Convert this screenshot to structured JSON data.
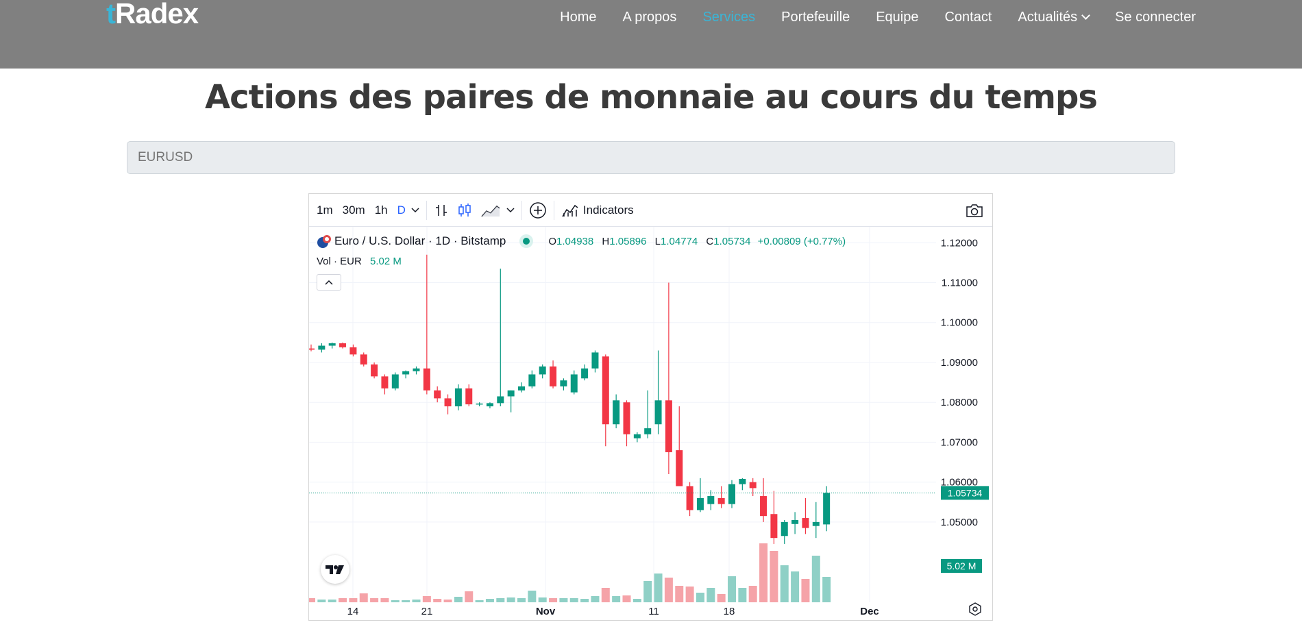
{
  "navbar": {
    "logo_prefix": "t",
    "logo_rest": "Radex",
    "links": [
      {
        "label": "Home"
      },
      {
        "label": "A propos"
      },
      {
        "label": "Services",
        "active": true
      },
      {
        "label": "Portefeuille"
      },
      {
        "label": "Equipe"
      },
      {
        "label": "Contact"
      },
      {
        "label": "Actualités",
        "dropdown": true
      },
      {
        "label": "Se connecter"
      }
    ]
  },
  "page": {
    "title": "Actions des paires de monnaie au cours du temps",
    "symbol_placeholder": "EURUSD"
  },
  "toolbar": {
    "intervals": [
      "1m",
      "30m",
      "1h",
      "D"
    ],
    "active_interval": "D",
    "indicators_label": "Indicators"
  },
  "legend": {
    "symbol_title": "Euro / U.S. Dollar · 1D · Bitstamp",
    "open_key": "O",
    "open": "1.04938",
    "high_key": "H",
    "high": "1.05896",
    "low_key": "L",
    "low": "1.04774",
    "close_key": "C",
    "close": "1.05734",
    "change": "+0.00809 (+0.77%)",
    "vol_label": "Vol · EUR",
    "vol_value": "5.02 M"
  },
  "colors": {
    "up": "#089981",
    "down": "#f23645",
    "up_vol": "#8fd0c6",
    "down_vol": "#f5a3a8",
    "accent": "#3ab5d6"
  },
  "chart_data": {
    "type": "candlestick",
    "y_ticks": [
      "1.12000",
      "1.11000",
      "1.10000",
      "1.09000",
      "1.08000",
      "1.07000",
      "1.06000",
      "1.05000"
    ],
    "x_ticks": [
      "14",
      "21",
      "Nov",
      "11",
      "18",
      "Dec"
    ],
    "last_price_label": "1.05734",
    "last_volume_label": "5.02 M",
    "ylim": [
      1.045,
      1.124
    ],
    "candles": [
      {
        "o": 1.0935,
        "h": 1.0945,
        "l": 1.0928,
        "c": 1.0932
      },
      {
        "o": 1.0932,
        "h": 1.0948,
        "l": 1.0925,
        "c": 1.0942
      },
      {
        "o": 1.0942,
        "h": 1.095,
        "l": 1.0935,
        "c": 1.0948
      },
      {
        "o": 1.0948,
        "h": 1.095,
        "l": 1.0935,
        "c": 1.0938
      },
      {
        "o": 1.0938,
        "h": 1.0945,
        "l": 1.0915,
        "c": 1.092
      },
      {
        "o": 1.092,
        "h": 1.0925,
        "l": 1.089,
        "c": 1.0895
      },
      {
        "o": 1.0895,
        "h": 1.09,
        "l": 1.086,
        "c": 1.0865
      },
      {
        "o": 1.0865,
        "h": 1.087,
        "l": 1.082,
        "c": 1.0835
      },
      {
        "o": 1.0835,
        "h": 1.0875,
        "l": 1.083,
        "c": 1.087
      },
      {
        "o": 1.087,
        "h": 1.088,
        "l": 1.086,
        "c": 1.0878
      },
      {
        "o": 1.0878,
        "h": 1.089,
        "l": 1.087,
        "c": 1.0885
      },
      {
        "o": 1.0885,
        "h": 1.117,
        "l": 1.082,
        "c": 1.083
      },
      {
        "o": 1.083,
        "h": 1.084,
        "l": 1.08,
        "c": 1.081
      },
      {
        "o": 1.081,
        "h": 1.082,
        "l": 1.077,
        "c": 1.079
      },
      {
        "o": 1.079,
        "h": 1.0845,
        "l": 1.078,
        "c": 1.0835
      },
      {
        "o": 1.0835,
        "h": 1.0845,
        "l": 1.079,
        "c": 1.0795
      },
      {
        "o": 1.0795,
        "h": 1.08,
        "l": 1.079,
        "c": 1.0797
      },
      {
        "o": 1.079,
        "h": 1.08,
        "l": 1.0785,
        "c": 1.0798
      },
      {
        "o": 1.0798,
        "h": 1.1135,
        "l": 1.079,
        "c": 1.0815
      },
      {
        "o": 1.0815,
        "h": 1.083,
        "l": 1.0775,
        "c": 1.083
      },
      {
        "o": 1.083,
        "h": 1.085,
        "l": 1.0825,
        "c": 1.084
      },
      {
        "o": 1.084,
        "h": 1.088,
        "l": 1.0835,
        "c": 1.087
      },
      {
        "o": 1.087,
        "h": 1.0895,
        "l": 1.086,
        "c": 1.089
      },
      {
        "o": 1.089,
        "h": 1.0905,
        "l": 1.0835,
        "c": 1.084
      },
      {
        "o": 1.084,
        "h": 1.086,
        "l": 1.083,
        "c": 1.0855
      },
      {
        "o": 1.0825,
        "h": 1.088,
        "l": 1.082,
        "c": 1.087
      },
      {
        "o": 1.086,
        "h": 1.0895,
        "l": 1.0855,
        "c": 1.0885
      },
      {
        "o": 1.0885,
        "h": 1.093,
        "l": 1.0875,
        "c": 1.0925
      },
      {
        "o": 1.0915,
        "h": 1.092,
        "l": 1.069,
        "c": 1.0745
      },
      {
        "o": 1.0745,
        "h": 1.082,
        "l": 1.0735,
        "c": 1.0805
      },
      {
        "o": 1.08,
        "h": 1.0805,
        "l": 1.069,
        "c": 1.072
      },
      {
        "o": 1.071,
        "h": 1.0725,
        "l": 1.07,
        "c": 1.072
      },
      {
        "o": 1.072,
        "h": 1.083,
        "l": 1.071,
        "c": 1.0735
      },
      {
        "o": 1.0745,
        "h": 1.093,
        "l": 1.072,
        "c": 1.0805
      },
      {
        "o": 1.0805,
        "h": 1.11,
        "l": 1.062,
        "c": 1.0675
      },
      {
        "o": 1.068,
        "h": 1.079,
        "l": 1.06,
        "c": 1.059
      },
      {
        "o": 1.059,
        "h": 1.06,
        "l": 1.0515,
        "c": 1.053
      },
      {
        "o": 1.053,
        "h": 1.061,
        "l": 1.0525,
        "c": 1.056
      },
      {
        "o": 1.0545,
        "h": 1.058,
        "l": 1.053,
        "c": 1.0565
      },
      {
        "o": 1.056,
        "h": 1.059,
        "l": 1.0535,
        "c": 1.0545
      },
      {
        "o": 1.0545,
        "h": 1.0605,
        "l": 1.0535,
        "c": 1.0595
      },
      {
        "o": 1.0595,
        "h": 1.061,
        "l": 1.058,
        "c": 1.0608
      },
      {
        "o": 1.06,
        "h": 1.061,
        "l": 1.0565,
        "c": 1.0585
      },
      {
        "o": 1.0565,
        "h": 1.061,
        "l": 1.05,
        "c": 1.0515
      },
      {
        "o": 1.052,
        "h": 1.0578,
        "l": 1.0445,
        "c": 1.046
      },
      {
        "o": 1.0465,
        "h": 1.0505,
        "l": 1.0445,
        "c": 1.05
      },
      {
        "o": 1.0495,
        "h": 1.0525,
        "l": 1.047,
        "c": 1.0505
      },
      {
        "o": 1.051,
        "h": 1.056,
        "l": 1.047,
        "c": 1.0485
      },
      {
        "o": 1.049,
        "h": 1.055,
        "l": 1.046,
        "c": 1.05
      },
      {
        "o": 1.0494,
        "h": 1.059,
        "l": 1.0477,
        "c": 1.0573
      }
    ],
    "volumes": [
      0.6,
      0.4,
      0.4,
      0.6,
      0.6,
      1.3,
      0.6,
      0.6,
      0.3,
      0.3,
      0.4,
      0.9,
      0.5,
      0.4,
      0.8,
      1.6,
      0.3,
      0.5,
      0.6,
      0.7,
      0.6,
      1.7,
      0.7,
      0.6,
      0.6,
      0.6,
      0.5,
      0.9,
      2.1,
      0.9,
      1.0,
      0.5,
      3.1,
      4.2,
      3.6,
      2.4,
      2.3,
      1.4,
      2.1,
      1.2,
      3.8,
      2.1,
      2.4,
      8.6,
      7.5,
      5.4,
      4.5,
      3.4,
      6.8,
      3.7
    ]
  }
}
